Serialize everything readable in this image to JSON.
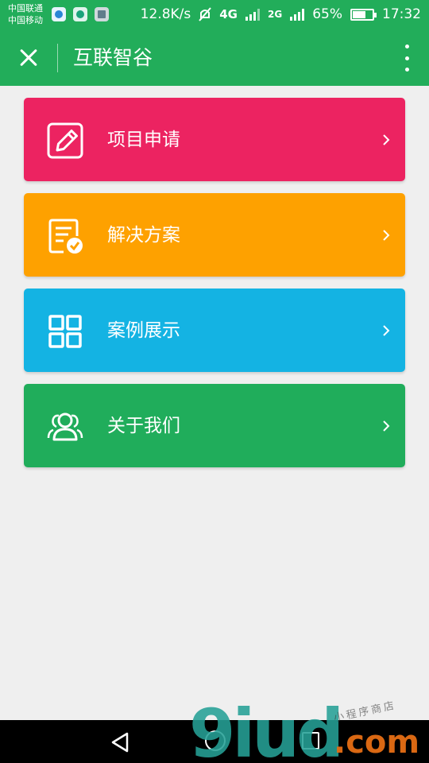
{
  "status_bar": {
    "carrier_1": "中国联通",
    "carrier_2": "中国移动",
    "net_speed": "12.8K/s",
    "network_1": "4G",
    "network_2": "2G",
    "battery_percent": "65%",
    "battery_level": 0.65,
    "time": "17:32"
  },
  "header": {
    "title": "互联智谷",
    "close_icon": "close-icon",
    "menu_icon": "more-vertical-icon"
  },
  "menu": {
    "items": [
      {
        "label": "项目申请",
        "icon": "edit-icon",
        "color": "#ec2361"
      },
      {
        "label": "解决方案",
        "icon": "document-check-icon",
        "color": "#fea100"
      },
      {
        "label": "案例展示",
        "icon": "grid-icon",
        "color": "#14b3e3"
      },
      {
        "label": "关于我们",
        "icon": "users-icon",
        "color": "#20ad5b"
      }
    ]
  },
  "watermark": {
    "logo": "9iud",
    "suffix": ".com",
    "tagline": "小程序商店"
  },
  "colors": {
    "header_bg": "#22ad5a",
    "page_bg": "#efefef"
  }
}
